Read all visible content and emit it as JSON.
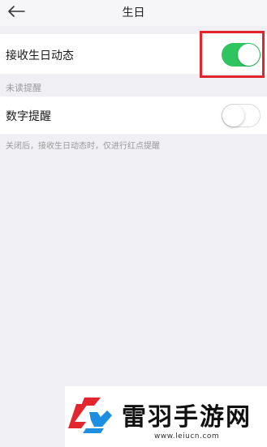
{
  "header": {
    "title": "生日",
    "back_icon": "arrow-left-icon"
  },
  "settings": {
    "birthday_updates": {
      "label": "接收生日动态",
      "enabled": true
    },
    "unread_section": {
      "label": "未读提醒"
    },
    "number_reminder": {
      "label": "数字提醒",
      "enabled": false
    },
    "hint": "关闭后，接收生日动态时，仅进行红点提醒"
  },
  "watermark": {
    "title": "雷羽手游网",
    "url": "www.leiucn.com",
    "logo_icon": "leiyu-logo-icon"
  },
  "colors": {
    "toggle_on": "#2ec55f",
    "highlight": "#e3262d",
    "background": "#efeff4"
  }
}
